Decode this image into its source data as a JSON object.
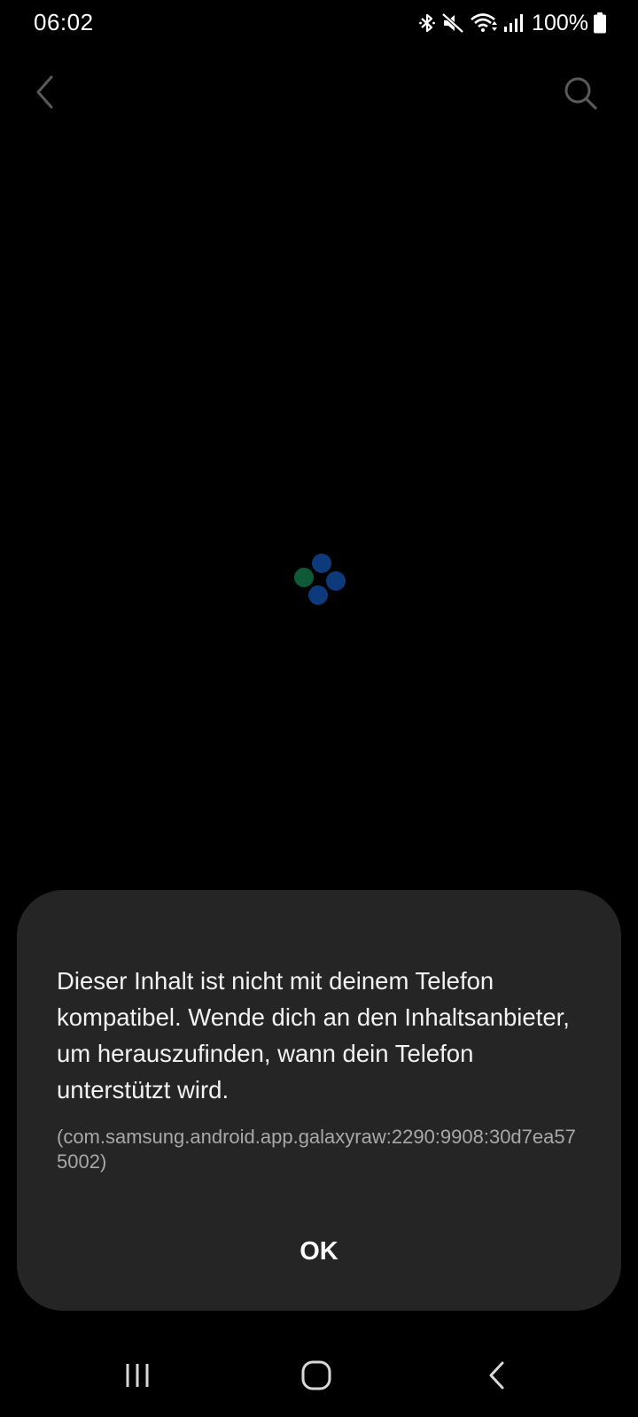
{
  "status_bar": {
    "time": "06:02",
    "battery": "100%",
    "icons": [
      "bluetooth-icon",
      "mute-icon",
      "wifi-icon",
      "signal-icon",
      "battery-icon"
    ]
  },
  "app_bar": {
    "icons": [
      "back-icon",
      "search-icon"
    ]
  },
  "loader": {
    "colors": [
      "#0d3a7a",
      "#0c5a37"
    ]
  },
  "dialog": {
    "message": "Dieser Inhalt ist nicht mit deinem Telefon kompatibel. Wende dich an den Inhaltsanbieter, um herauszufinden, wann dein Telefon unterstützt wird.",
    "code": "(com.samsung.android.app.galaxyraw:2290:9908:30d7ea575002)",
    "ok_label": "OK"
  },
  "nav_bar": {
    "icons": [
      "recents-icon",
      "home-icon",
      "back-icon"
    ]
  }
}
